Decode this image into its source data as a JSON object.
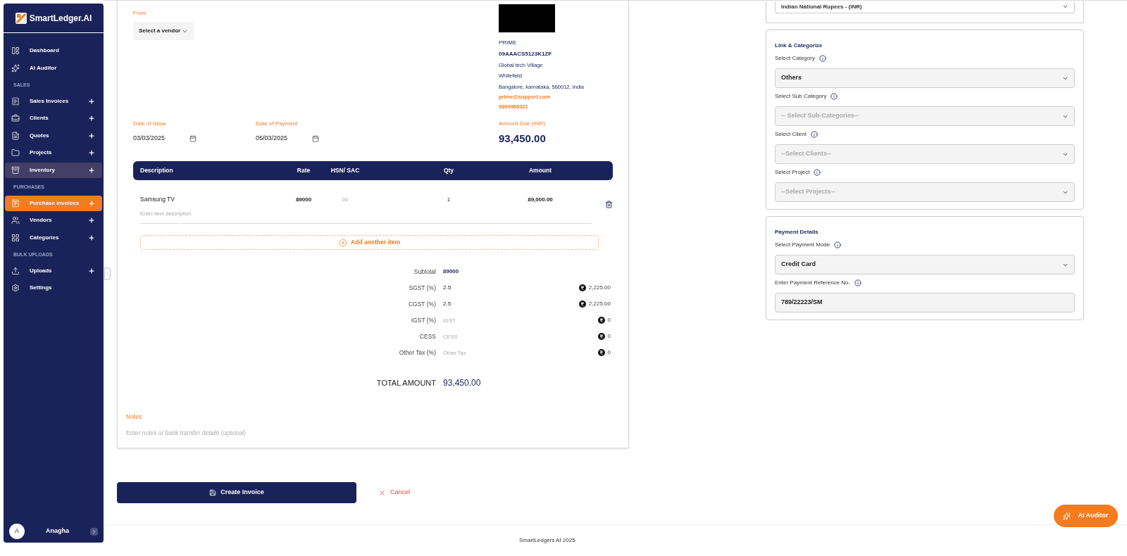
{
  "sidebar": {
    "logo": "SmartLedger.AI",
    "sections": [
      {
        "items": [
          {
            "label": "Dashboard",
            "has_add": false,
            "selected": false,
            "hovered": false
          },
          {
            "label": "AI Auditor",
            "has_add": false,
            "selected": false,
            "hovered": false
          }
        ]
      },
      {
        "heading": "SALES",
        "items": [
          {
            "label": "Sales Invoices",
            "has_add": true,
            "selected": false,
            "hovered": false
          },
          {
            "label": "Clients",
            "has_add": true,
            "selected": false,
            "hovered": false
          },
          {
            "label": "Quotes",
            "has_add": true,
            "selected": false,
            "hovered": false
          },
          {
            "label": "Projects",
            "has_add": true,
            "selected": false,
            "hovered": false
          },
          {
            "label": "Inventory",
            "has_add": true,
            "selected": false,
            "hovered": true
          }
        ]
      },
      {
        "heading": "PURCHASES",
        "items": [
          {
            "label": "Purchase Invoices",
            "has_add": true,
            "selected": true,
            "hovered": false
          },
          {
            "label": "Vendors",
            "has_add": true,
            "selected": false,
            "hovered": false
          },
          {
            "label": "Categories",
            "has_add": true,
            "selected": false,
            "hovered": false
          }
        ]
      },
      {
        "heading": "BULK UPLOADS",
        "items": [
          {
            "label": "Uploads",
            "has_add": true,
            "selected": false,
            "hovered": false
          },
          {
            "label": "Settings",
            "has_add": false,
            "selected": false,
            "hovered": false
          }
        ]
      }
    ],
    "user": {
      "initial": "A",
      "name": "Anagha"
    }
  },
  "invoice": {
    "from_label": "From",
    "vendor_select": "Select a vendor",
    "vendor": {
      "name": "PRIME",
      "gstin": "09AAACS5123K1ZF",
      "address": [
        "Global tech Village",
        "Whitefield",
        "Bangalore, karnataka, 560012, India"
      ],
      "email": "prime@support.com",
      "phone": "9899966321"
    },
    "dates": [
      {
        "label": "Date of issue",
        "value": "03/03/2025"
      },
      {
        "label": "Date of Payment",
        "value": "05/03/2025"
      }
    ],
    "amount_due": {
      "label": "Amount Due (INR)",
      "value": "93,450.00"
    },
    "table": {
      "columns": [
        "Description",
        "Rate",
        "HSN/ SAC",
        "Qty",
        "Amount"
      ],
      "rows": [
        {
          "description": "Samsung TV",
          "description_placeholder": "Enter item description",
          "rate": "89000",
          "hsn_placeholder": "00",
          "qty": "1",
          "amount": "89,000.00"
        }
      ]
    },
    "add_item": "Add another item",
    "totals": [
      {
        "label": "Subtotal",
        "value": "89000",
        "kind": "subtotal"
      },
      {
        "label": "SGST (%)",
        "value": "2.5",
        "amount": "2,225.00",
        "kind": "tax"
      },
      {
        "label": "CGST (%)",
        "value": "2.5",
        "amount": "2,225.00",
        "kind": "tax"
      },
      {
        "label": "IGST (%)",
        "placeholder": "IGST",
        "amount": "0",
        "kind": "tax"
      },
      {
        "label": "CESS",
        "placeholder": "CESS",
        "amount": "0",
        "kind": "tax"
      },
      {
        "label": "Other Tax (%)",
        "placeholder": "Other Tax",
        "amount": "0",
        "kind": "tax"
      }
    ],
    "total": {
      "label": "TOTAL AMOUNT",
      "value": "93,450.00"
    },
    "notes": {
      "label": "Notes",
      "placeholder": "Enter notes or bank transfer details (optional)"
    }
  },
  "actions": {
    "create": "Create Invoice",
    "cancel": "Cancel"
  },
  "currency_select": "Indian National Rupees - (INR)",
  "panels": [
    {
      "title": "Link & Categorize",
      "fields": [
        {
          "label": "Select Category",
          "value": "Others",
          "kind": "select"
        },
        {
          "label": "Select Sub Category",
          "placeholder": "-- Select Sub-Categories--",
          "kind": "select"
        },
        {
          "label": "Select Client",
          "placeholder": "--Select Clients--",
          "kind": "select"
        },
        {
          "label": "Select Project",
          "placeholder": "--Select Projects--",
          "kind": "select"
        }
      ]
    },
    {
      "title": "Payment Details",
      "fields": [
        {
          "label": "Select Payment Mode",
          "value": "Credit Card",
          "kind": "select"
        },
        {
          "label": "Enter Payment Reference No.",
          "value": "789/22223/SM",
          "kind": "input"
        }
      ]
    }
  ],
  "footer": "SmartLedgers AI 2025",
  "ai_button": "AI Auditor"
}
